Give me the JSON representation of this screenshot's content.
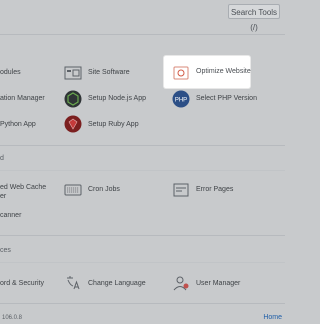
{
  "topbar": {
    "search_tools": "Search Tools (/)"
  },
  "software_section": {
    "items": [
      {
        "label": "odules"
      },
      {
        "label": "Site Software"
      },
      {
        "label": "Optimize Website"
      },
      {
        "label": "ation Manager"
      },
      {
        "label": "Setup Node.js App"
      },
      {
        "label": "Select PHP Version"
      },
      {
        "label": "Python App"
      },
      {
        "label": "Setup Ruby App"
      }
    ]
  },
  "advanced_section": {
    "title": "d",
    "items": [
      {
        "label": "ed Web Cache"
      },
      {
        "label": "er"
      },
      {
        "label": "Cron Jobs"
      },
      {
        "label": "Error Pages"
      },
      {
        "label": "canner"
      }
    ]
  },
  "preferences_section": {
    "title": "ces",
    "items": [
      {
        "label": "ord & Security"
      },
      {
        "label": "Change Language"
      },
      {
        "label": "User Manager"
      }
    ]
  },
  "footer": {
    "version": "106.0.8",
    "home": "Home"
  },
  "colors": {
    "background": "#c8cacc",
    "highlight": "#ffffff",
    "link": "#1f5fa8"
  },
  "icons": {
    "site_software": "site-software-icon",
    "optimize_website": "optimize-website-icon",
    "nodejs": "nodejs-icon",
    "php": "php-icon",
    "ruby": "ruby-icon",
    "cron": "cron-jobs-icon",
    "error_pages": "error-pages-icon",
    "change_language": "change-language-icon",
    "user_manager": "user-manager-icon"
  }
}
